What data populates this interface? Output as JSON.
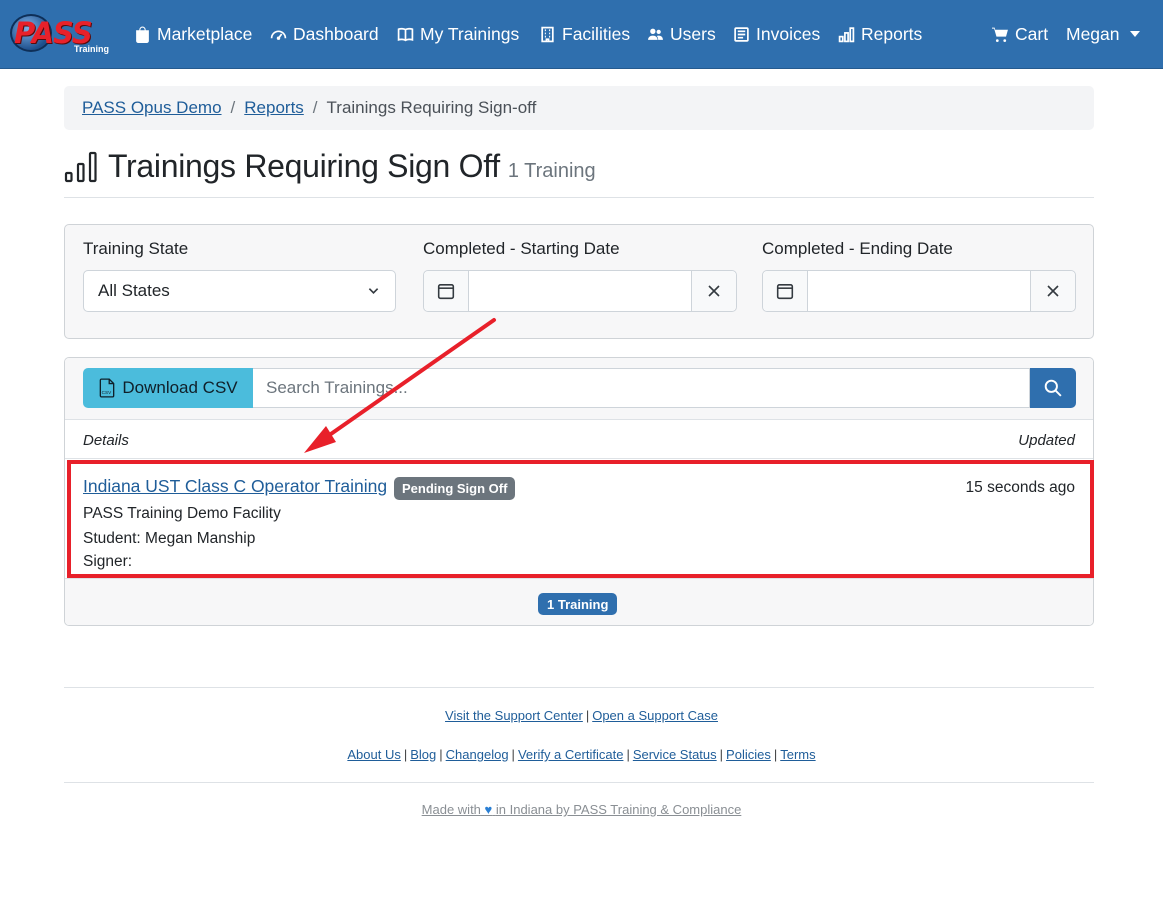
{
  "navbar": {
    "logo_text": "PASS",
    "logo_sub": "Training",
    "items": [
      {
        "label": "Marketplace",
        "icon": "bag-icon"
      },
      {
        "label": "Dashboard",
        "icon": "speedometer-icon"
      },
      {
        "label": "My Trainings",
        "icon": "book-icon"
      },
      {
        "label": "Facilities",
        "icon": "building-icon"
      },
      {
        "label": "Users",
        "icon": "people-icon"
      },
      {
        "label": "Invoices",
        "icon": "receipt-icon"
      },
      {
        "label": "Reports",
        "icon": "bar-chart-icon"
      }
    ],
    "cart_label": "Cart",
    "user_label": "Megan"
  },
  "breadcrumb": {
    "items": [
      "PASS Opus Demo",
      "Reports"
    ],
    "current": "Trainings Requiring Sign-off",
    "separator": "/"
  },
  "heading": {
    "title": "Trainings Requiring Sign Off",
    "count": "1 Training"
  },
  "filters": {
    "state_label": "Training State",
    "state_value": "All States",
    "start_label": "Completed - Starting Date",
    "end_label": "Completed - Ending Date"
  },
  "list": {
    "csv_label": "Download CSV",
    "search_placeholder": "Search Trainings...",
    "col_details": "Details",
    "col_updated": "Updated",
    "rows": [
      {
        "title": "Indiana UST Class C Operator Training",
        "status": "Pending Sign Off",
        "facility": "PASS Training Demo Facility",
        "student": "Student: Megan Manship",
        "signer": "Signer:",
        "updated": "15 seconds ago"
      }
    ],
    "footer_badge": "1 Training"
  },
  "footer": {
    "support_center": "Visit the Support Center",
    "open_case": "Open a Support Case",
    "links": [
      "About Us",
      "Blog",
      "Changelog",
      "Verify a Certificate",
      "Service Status",
      "Policies",
      "Terms"
    ],
    "made_prefix": "Made with",
    "made_suffix": "in Indiana by PASS Training & Compliance"
  },
  "colors": {
    "navbar": "#2f6fae",
    "highlight": "#e8202a",
    "csv_button": "#4bbcdc",
    "badge_gray": "#6c757d",
    "badge_blue": "#2f6fae"
  }
}
